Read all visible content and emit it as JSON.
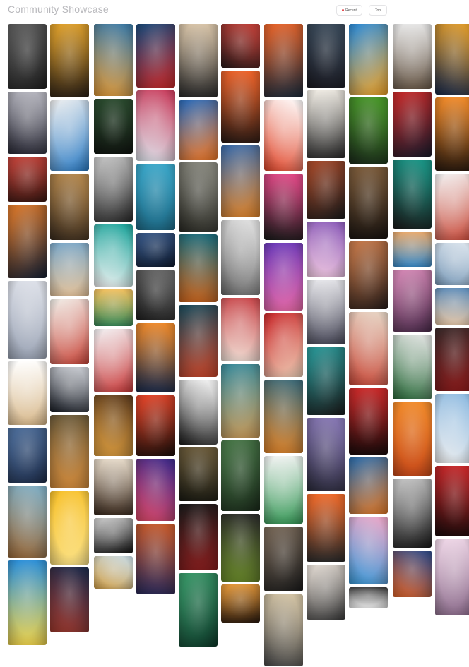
{
  "page": {
    "title": "Community Showcase"
  },
  "filters": {
    "recent_label": "Recent",
    "top_label": "Top",
    "active_dot_color": "#e5484d"
  },
  "gallery": {
    "columns": [
      {
        "tiles": [
          {
            "h": 92,
            "c1": "#5e5e5e",
            "c2": "#1f1f1f"
          },
          {
            "h": 88,
            "c1": "#b9b9c2",
            "c2": "#2a2a36"
          },
          {
            "h": 64,
            "c1": "#c2433a",
            "c2": "#3a1712"
          },
          {
            "h": 104,
            "c1": "#e07a2a",
            "c2": "#152033"
          },
          {
            "h": 110,
            "c1": "#dfe2ea",
            "c2": "#9aa3b4"
          },
          {
            "h": 90,
            "c1": "#ffffff",
            "c2": "#d8b98c"
          },
          {
            "h": 78,
            "c1": "#4e6f9c",
            "c2": "#1e2d4a"
          },
          {
            "h": 102,
            "c1": "#7fb0c8",
            "c2": "#9b6a3a"
          },
          {
            "h": 120,
            "c1": "#2c8fd8",
            "c2": "#f0d44c"
          }
        ]
      },
      {
        "tiles": [
          {
            "h": 104,
            "c1": "#e0a12c",
            "c2": "#2b2016"
          },
          {
            "h": 100,
            "c1": "#f1f1f1",
            "c2": "#2b7bc4"
          },
          {
            "h": 94,
            "c1": "#b88a4e",
            "c2": "#3a2c1e"
          },
          {
            "h": 76,
            "c1": "#7ba7c7",
            "c2": "#e6c39a"
          },
          {
            "h": 92,
            "c1": "#f2f0ea",
            "c2": "#c8463a"
          },
          {
            "h": 64,
            "c1": "#d1d4da",
            "c2": "#1a1e26"
          },
          {
            "h": 104,
            "c1": "#6b5a3a",
            "c2": "#d08a3c"
          },
          {
            "h": 104,
            "c1": "#f7c02a",
            "c2": "#fbe38a"
          },
          {
            "h": 92,
            "c1": "#1b2a4a",
            "c2": "#a23a2e"
          }
        ]
      },
      {
        "tiles": [
          {
            "h": 102,
            "c1": "#3a7aa8",
            "c2": "#e09a3a"
          },
          {
            "h": 78,
            "c1": "#2a4a2e",
            "c2": "#101510"
          },
          {
            "h": 92,
            "c1": "#c9c9c9",
            "c2": "#2a2a2a"
          },
          {
            "h": 88,
            "c1": "#1aa39a",
            "c2": "#f4f4f4"
          },
          {
            "h": 52,
            "c1": "#f0c060",
            "c2": "#3a8a5a"
          },
          {
            "h": 90,
            "c1": "#f4f4f6",
            "c2": "#c83a3a"
          },
          {
            "h": 86,
            "c1": "#5a3a1e",
            "c2": "#e0a040"
          },
          {
            "h": 80,
            "c1": "#e8dccb",
            "c2": "#3a2a1e"
          },
          {
            "h": 50,
            "c1": "#d0d0d0",
            "c2": "#111111"
          },
          {
            "h": 46,
            "c1": "#c8ddea",
            "c2": "#d4a24a"
          }
        ]
      },
      {
        "tiles": [
          {
            "h": 90,
            "c1": "#1a4a7a",
            "c2": "#c82a2a"
          },
          {
            "h": 100,
            "c1": "#c83a5a",
            "c2": "#dfe6ee"
          },
          {
            "h": 94,
            "c1": "#3aa6c8",
            "c2": "#1e6a86"
          },
          {
            "h": 48,
            "c1": "#3a5a8a",
            "c2": "#0e1a2e"
          },
          {
            "h": 72,
            "c1": "#6a6a6a",
            "c2": "#1f1f1f"
          },
          {
            "h": 98,
            "c1": "#f08a2a",
            "c2": "#1a2a4a"
          },
          {
            "h": 86,
            "c1": "#e8462a",
            "c2": "#1a0e0a"
          },
          {
            "h": 88,
            "c1": "#3a2a8a",
            "c2": "#e04a6a"
          },
          {
            "h": 100,
            "c1": "#c85a2a",
            "c2": "#2a2a5a"
          }
        ]
      },
      {
        "tiles": [
          {
            "h": 104,
            "c1": "#d8c4a8",
            "c2": "#2a2a2a"
          },
          {
            "h": 84,
            "c1": "#2a6ab8",
            "c2": "#f07a2a"
          },
          {
            "h": 98,
            "c1": "#8a8a80",
            "c2": "#2a2a24"
          },
          {
            "h": 96,
            "c1": "#1a6a7a",
            "c2": "#c8641e"
          },
          {
            "h": 102,
            "c1": "#1a4a5a",
            "c2": "#c8462a"
          },
          {
            "h": 92,
            "c1": "#ffffff",
            "c2": "#1a1a1a"
          },
          {
            "h": 76,
            "c1": "#6a5a3a",
            "c2": "#1a1a12"
          },
          {
            "h": 94,
            "c1": "#1a1a1a",
            "c2": "#8a1e1e"
          },
          {
            "h": 104,
            "c1": "#3a9a6a",
            "c2": "#0e3a2a"
          }
        ]
      },
      {
        "tiles": [
          {
            "h": 62,
            "c1": "#c8423a",
            "c2": "#2a1a1a"
          },
          {
            "h": 102,
            "c1": "#f0642a",
            "c2": "#2a1a14"
          },
          {
            "h": 102,
            "c1": "#3a6aa8",
            "c2": "#e0842a"
          },
          {
            "h": 106,
            "c1": "#e6e6e6",
            "c2": "#6a6a6a"
          },
          {
            "h": 90,
            "c1": "#c8464a",
            "c2": "#f2e2d8"
          },
          {
            "h": 104,
            "c1": "#3a8a9a",
            "c2": "#c89a5a"
          },
          {
            "h": 100,
            "c1": "#4a7a4a",
            "c2": "#1a2a1a"
          },
          {
            "h": 96,
            "c1": "#2a2a2a",
            "c2": "#6a8a2a"
          },
          {
            "h": 54,
            "c1": "#e89a3a",
            "c2": "#2a1a0e"
          }
        ]
      },
      {
        "tiles": [
          {
            "h": 104,
            "c1": "#e8642a",
            "c2": "#1a2a3a"
          },
          {
            "h": 100,
            "c1": "#ffffff",
            "c2": "#e0462a"
          },
          {
            "h": 94,
            "c1": "#e84a8a",
            "c2": "#1a1a1a"
          },
          {
            "h": 96,
            "c1": "#6a3ab8",
            "c2": "#e86aa8"
          },
          {
            "h": 90,
            "c1": "#c8282a",
            "c2": "#f0d0b8"
          },
          {
            "h": 104,
            "c1": "#3a6a7a",
            "c2": "#e0842a"
          },
          {
            "h": 96,
            "c1": "#f4f4f4",
            "c2": "#3a9a5a"
          },
          {
            "h": 92,
            "c1": "#7a6a5a",
            "c2": "#1a1a1a"
          },
          {
            "h": 104,
            "c1": "#d8c8a8",
            "c2": "#4a4a4a"
          }
        ]
      },
      {
        "tiles": [
          {
            "h": 90,
            "c1": "#3a4a5a",
            "c2": "#1a1a22"
          },
          {
            "h": 96,
            "c1": "#f2eee6",
            "c2": "#2a2a2a"
          },
          {
            "h": 82,
            "c1": "#a84a2a",
            "c2": "#1a1a1a"
          },
          {
            "h": 78,
            "c1": "#8a5ab8",
            "c2": "#f0c8e0"
          },
          {
            "h": 92,
            "c1": "#e8e8ec",
            "c2": "#4a4a5a"
          },
          {
            "h": 96,
            "c1": "#2a9a9a",
            "c2": "#1a1a1a"
          },
          {
            "h": 104,
            "c1": "#8a7ab8",
            "c2": "#2a2a3a"
          },
          {
            "h": 96,
            "c1": "#f06a2a",
            "c2": "#2a2a2a"
          },
          {
            "h": 78,
            "c1": "#e8e0d8",
            "c2": "#3a3a3a"
          }
        ]
      },
      {
        "tiles": [
          {
            "h": 100,
            "c1": "#2a8ad8",
            "c2": "#f0a42a"
          },
          {
            "h": 94,
            "c1": "#4a9a2a",
            "c2": "#1a2a1a"
          },
          {
            "h": 102,
            "c1": "#7a5a3a",
            "c2": "#1a1410"
          },
          {
            "h": 96,
            "c1": "#c87a4a",
            "c2": "#2a1e1a"
          },
          {
            "h": 104,
            "c1": "#e8d8c8",
            "c2": "#c84a3a"
          },
          {
            "h": 94,
            "c1": "#c82a2a",
            "c2": "#1a0a0a"
          },
          {
            "h": 80,
            "c1": "#2a6aa8",
            "c2": "#e07a2a"
          },
          {
            "h": 96,
            "c1": "#f0a8c8",
            "c2": "#3a9ad8"
          },
          {
            "h": 30,
            "c1": "#3a3a3a",
            "c2": "#f0f0f0"
          }
        ]
      },
      {
        "tiles": [
          {
            "h": 92,
            "c1": "#e8e8e8",
            "c2": "#6a5a4a"
          },
          {
            "h": 92,
            "c1": "#c82a2a",
            "c2": "#1a1a2a"
          },
          {
            "h": 98,
            "c1": "#1a9a8a",
            "c2": "#1a1a1a"
          },
          {
            "h": 50,
            "c1": "#e8a86a",
            "c2": "#3a8ac8"
          },
          {
            "h": 88,
            "c1": "#d88ab8",
            "c2": "#4a2a4a"
          },
          {
            "h": 92,
            "c1": "#e8e8e8",
            "c2": "#2a6a3a"
          },
          {
            "h": 104,
            "c1": "#f08a2a",
            "c2": "#c84a1a"
          },
          {
            "h": 98,
            "c1": "#c8c8c8",
            "c2": "#1a1a1a"
          },
          {
            "h": 66,
            "c1": "#2a4a8a",
            "c2": "#e0642a"
          }
        ]
      },
      {
        "tiles": [
          {
            "h": 100,
            "c1": "#e8a02a",
            "c2": "#1a2a4a"
          },
          {
            "h": 104,
            "c1": "#f08a2a",
            "c2": "#2a1a0e"
          },
          {
            "h": 94,
            "c1": "#f4f4f4",
            "c2": "#c84a3a"
          },
          {
            "h": 60,
            "c1": "#e0e8f0",
            "c2": "#7a9ab8"
          },
          {
            "h": 52,
            "c1": "#5a8ab8",
            "c2": "#e8c8a8"
          },
          {
            "h": 90,
            "c1": "#3a2a2a",
            "c2": "#8a1a1a"
          },
          {
            "h": 98,
            "c1": "#8ab8e0",
            "c2": "#f0f0f0"
          },
          {
            "h": 100,
            "c1": "#c8282a",
            "c2": "#1a0a0a"
          },
          {
            "h": 108,
            "c1": "#f0d8e8",
            "c2": "#8a6a8a"
          }
        ]
      }
    ]
  }
}
